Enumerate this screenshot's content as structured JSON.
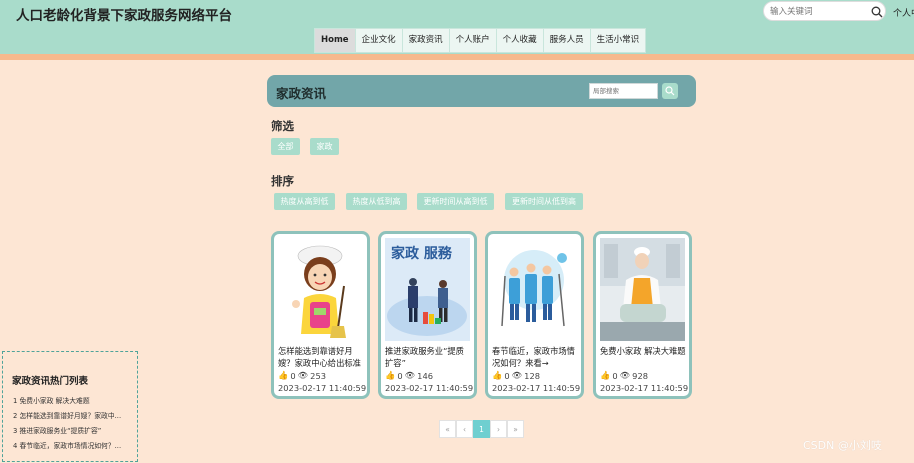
{
  "site": {
    "title": "人口老龄化背景下家政服务网络平台",
    "user_link": "个人中"
  },
  "search": {
    "placeholder": "输入关键词"
  },
  "nav": {
    "items": [
      "Home",
      "企业文化",
      "家政资讯",
      "个人账户",
      "个人收藏",
      "服务人员",
      "生活小常识"
    ],
    "active": "Home"
  },
  "section": {
    "title": "家政资讯",
    "local_search_placeholder": "局部搜索"
  },
  "filter": {
    "label": "筛选",
    "chips": [
      "全部",
      "家政"
    ]
  },
  "sort": {
    "label": "排序",
    "chips": [
      "热度从高到低",
      "热度从低到高",
      "更新时间从高到低",
      "更新时间从低到高"
    ]
  },
  "cards": [
    {
      "title": "怎样能选到靠谱好月嫂？家政中心给出标准",
      "likes": "0",
      "views": "253",
      "date": "2023-02-17 11:40:59",
      "image": "cartoon-housekeeper-with-mop"
    },
    {
      "title": "推进家政服务业“提质扩容”",
      "likes": "0",
      "views": "146",
      "date": "2023-02-17 11:40:59",
      "image": "household-service-illustration"
    },
    {
      "title": "春节临近，家政市场情况如何？来看→",
      "likes": "0",
      "views": "128",
      "date": "2023-02-17 11:40:59",
      "image": "cleaning-team-illustration"
    },
    {
      "title": "免费小家政 解决大难题",
      "likes": "0",
      "views": "928",
      "date": "2023-02-17 11:40:59",
      "image": "cook-in-kitchen-photo"
    }
  ],
  "hot_list": {
    "title": "家政资讯热门列表",
    "items": [
      "1  免费小家政 解决大难题",
      "2  怎样能选到靠谱好月嫂？家政中...",
      "3  推进家政服务业“提质扩容”",
      "4  春节临近，家政市场情况如何？..."
    ]
  },
  "pagination": {
    "first": "«",
    "prev": "‹",
    "current": "1",
    "next": "›",
    "last": "»"
  },
  "watermark": "CSDN @小刘吱",
  "colors": {
    "header_bg": "#a9dccb",
    "page_bg": "#fde6d4",
    "accent_strip": "#f6b98d",
    "section_bar": "#72a6a9",
    "chip": "#a9dccb",
    "pager_active": "#6fcfd0"
  }
}
